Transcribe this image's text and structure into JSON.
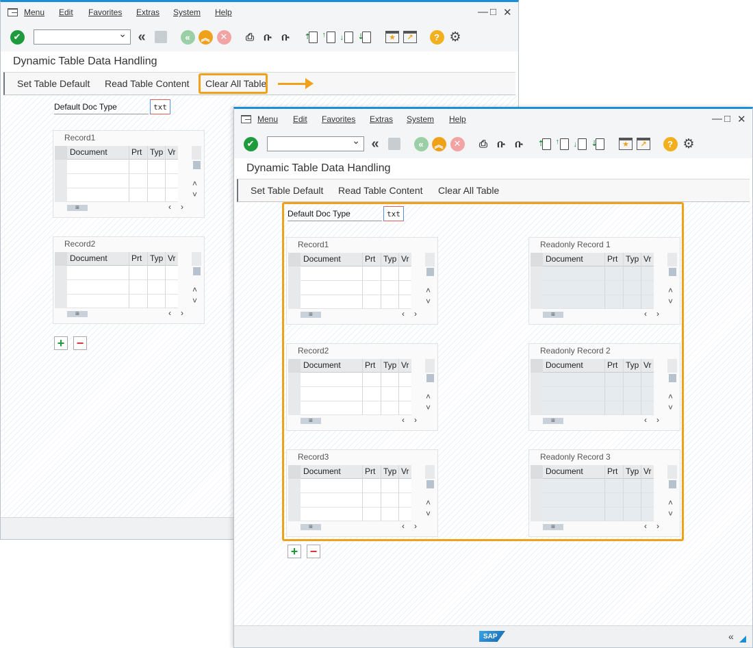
{
  "menubar": {
    "items": [
      "Menu",
      "Edit",
      "Favorites",
      "Extras",
      "System",
      "Help"
    ],
    "window_controls": [
      "—",
      "□",
      "✕"
    ]
  },
  "toolbar": {
    "icons": [
      "enter-icon",
      "command-field",
      "back-icon",
      "save-icon",
      "exit-icon",
      "up-icon",
      "cancel-icon",
      "print-icon",
      "find-icon",
      "find-next-icon",
      "first-page-icon",
      "prev-page-icon",
      "next-page-icon",
      "last-page-icon",
      "create-session-icon",
      "shortcut-icon",
      "help-icon",
      "settings-icon"
    ]
  },
  "screen": {
    "title": "Dynamic Table Data Handling",
    "buttons": [
      "Set Table Default",
      "Read Table Content",
      "Clear All Table"
    ],
    "field_label": "Default Doc Type",
    "field_value": "txt"
  },
  "table": {
    "columns": [
      "Document",
      "Prt",
      "Typ",
      "Vr"
    ],
    "hscroll_label": "⊞"
  },
  "win1": {
    "panels": [
      "Record1",
      "Record2"
    ]
  },
  "win2": {
    "left_panels": [
      "Record1",
      "Record2",
      "Record3"
    ],
    "right_panels": [
      "Readonly Record 1",
      "Readonly Record 2",
      "Readonly Record 3"
    ],
    "footer_logo": "SAP",
    "collapse_label": "«"
  },
  "colors": {
    "highlight": "#f0a11a",
    "sap_blue": "#1b8fd6",
    "add_green": "#1e9b33",
    "remove_red": "#d73535"
  }
}
